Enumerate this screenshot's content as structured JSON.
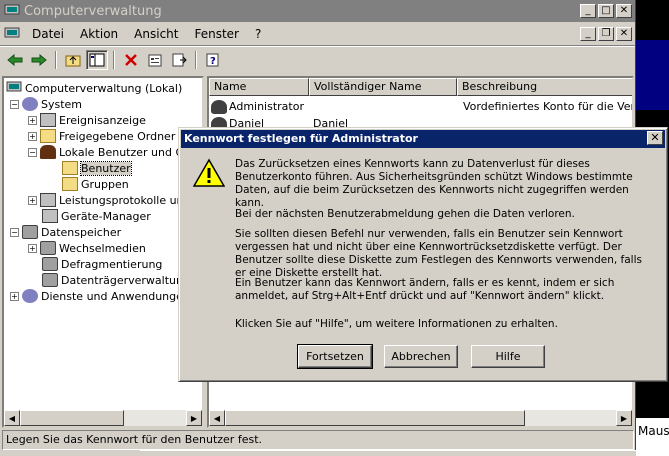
{
  "window": {
    "title": "Computerverwaltung",
    "buttons": {
      "minimize": "_",
      "maximize": "□",
      "close": "✕"
    }
  },
  "menu": {
    "items": [
      "Datei",
      "Aktion",
      "Ansicht",
      "Fenster",
      "?"
    ],
    "child_buttons": {
      "minimize": "_",
      "restore": "❐",
      "close": "✕"
    }
  },
  "toolbar": {
    "icons": [
      "back-arrow-icon",
      "forward-arrow-icon",
      "up-folder-icon",
      "show-tree-icon",
      "delete-icon",
      "properties-icon",
      "export-list-icon",
      "help-icon"
    ]
  },
  "tree": {
    "nodes": [
      {
        "label": "Computerverwaltung (Lokal)",
        "depth": 0,
        "expander": "",
        "icon": "computer-icon"
      },
      {
        "label": "System",
        "depth": 1,
        "expander": "−",
        "icon": "system-tools-icon"
      },
      {
        "label": "Ereignisanzeige",
        "depth": 2,
        "expander": "+",
        "icon": "event-viewer-icon"
      },
      {
        "label": "Freigegebene Ordner",
        "depth": 2,
        "expander": "+",
        "icon": "shared-folder-icon"
      },
      {
        "label": "Lokale Benutzer und Gru",
        "depth": 2,
        "expander": "−",
        "icon": "users-groups-icon"
      },
      {
        "label": "Benutzer",
        "depth": 3,
        "expander": "",
        "icon": "folder-icon",
        "selected": true
      },
      {
        "label": "Gruppen",
        "depth": 3,
        "expander": "",
        "icon": "folder-icon"
      },
      {
        "label": "Leistungsprotokolle und",
        "depth": 2,
        "expander": "+",
        "icon": "performance-logs-icon"
      },
      {
        "label": "Geräte-Manager",
        "depth": 2,
        "expander": "",
        "icon": "device-manager-icon"
      },
      {
        "label": "Datenspeicher",
        "depth": 1,
        "expander": "−",
        "icon": "storage-icon"
      },
      {
        "label": "Wechselmedien",
        "depth": 2,
        "expander": "+",
        "icon": "removable-media-icon"
      },
      {
        "label": "Defragmentierung",
        "depth": 2,
        "expander": "",
        "icon": "defrag-icon"
      },
      {
        "label": "Datenträgerverwaltung",
        "depth": 2,
        "expander": "",
        "icon": "disk-management-icon"
      },
      {
        "label": "Dienste und Anwendungen",
        "depth": 1,
        "expander": "+",
        "icon": "services-icon"
      }
    ]
  },
  "list": {
    "columns": [
      "Name",
      "Vollständiger Name",
      "Beschreibung"
    ],
    "rows": [
      {
        "name": "Administrator",
        "full_name": "",
        "description": "Vordefiniertes Konto für die Verwal"
      },
      {
        "name": "Daniel",
        "full_name": "Daniel",
        "description": ""
      }
    ]
  },
  "statusbar": {
    "text": "Legen Sie das Kennwort für den Benutzer fest."
  },
  "background_app": {
    "text": "Maus"
  },
  "dialog": {
    "title": "Kennwort festlegen für Administrator",
    "close": "✕",
    "paragraphs": [
      "Das Zurücksetzen eines Kennworts kann zu Datenverlust für dieses Benutzerkonto führen. Aus Sicherheitsgründen schützt Windows bestimmte Daten, auf die beim Zurücksetzen des Kennworts nicht zugegriffen werden kann.",
      "Bei der nächsten Benutzerabmeldung gehen die Daten verloren.",
      "Sie sollten diesen Befehl nur verwenden, falls ein Benutzer sein Kennwort vergessen hat und nicht über eine Kennwortrücksetzdiskette verfügt. Der Benutzer sollte diese Diskette zum Festlegen des Kennworts verwenden, falls er eine Diskette erstellt hat.",
      "Ein Benutzer kann das Kennwort ändern, falls er es kennt, indem er sich anmeldet, auf Strg+Alt+Entf drückt und auf \"Kennwort ändern\" klickt.",
      "Klicken Sie auf \"Hilfe\", um weitere Informationen zu erhalten."
    ],
    "buttons": {
      "continue": "Fortsetzen",
      "cancel": "Abbrechen",
      "help": "Hilfe"
    }
  }
}
